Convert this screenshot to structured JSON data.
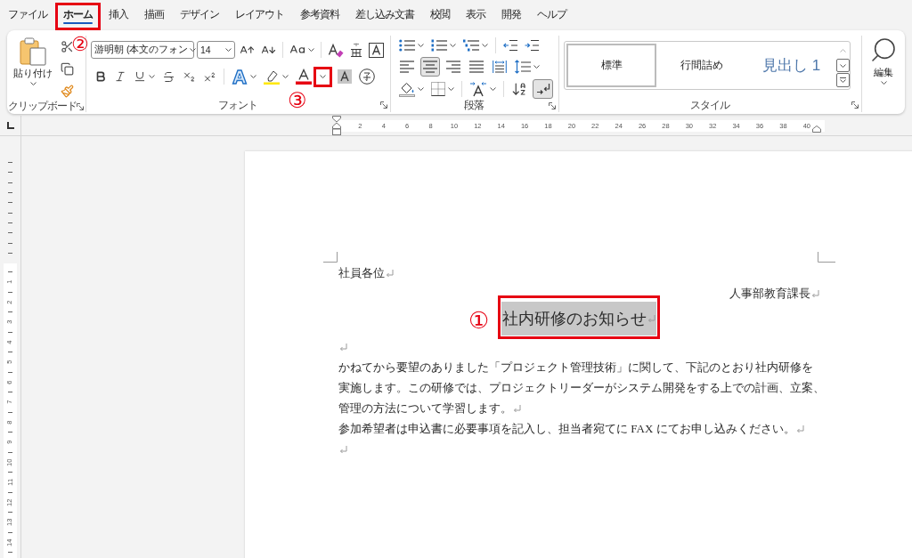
{
  "menu_tabs": [
    {
      "label": "ファイル",
      "selected": false,
      "framed": false
    },
    {
      "label": "ホーム",
      "selected": true,
      "framed": true,
      "callout": "②"
    },
    {
      "label": "挿入",
      "selected": false,
      "framed": false
    },
    {
      "label": "描画",
      "selected": false,
      "framed": false
    },
    {
      "label": "デザイン",
      "selected": false,
      "framed": false
    },
    {
      "label": "レイアウト",
      "selected": false,
      "framed": false
    },
    {
      "label": "参考資料",
      "selected": false,
      "framed": false
    },
    {
      "label": "差し込み文書",
      "selected": false,
      "framed": false
    },
    {
      "label": "校閲",
      "selected": false,
      "framed": false
    },
    {
      "label": "表示",
      "selected": false,
      "framed": false
    },
    {
      "label": "開発",
      "selected": false,
      "framed": false
    },
    {
      "label": "ヘルプ",
      "selected": false,
      "framed": false
    }
  ],
  "ribbon": {
    "clipboard": {
      "paste_label": "貼り付け",
      "group_label": "クリップボード"
    },
    "font": {
      "font_name": "游明朝 (本文のフォン",
      "font_size": "14",
      "font_color_dropdown": {
        "framed": true,
        "callout": "③"
      },
      "group_label": "フォント"
    },
    "paragraph": {
      "alignment": [
        {
          "selected": false
        },
        {
          "selected": true
        },
        {
          "selected": false
        },
        {
          "selected": false
        },
        {
          "selected": false
        }
      ],
      "show_marks": {
        "on": true
      },
      "group_label": "段落"
    },
    "styles": {
      "items": [
        {
          "label": "標準",
          "kind": "normal",
          "selected": true
        },
        {
          "label": "行間詰め",
          "kind": "normal",
          "selected": false
        },
        {
          "label": "見出し 1",
          "kind": "heading",
          "selected": false
        }
      ],
      "group_label": "スタイル"
    },
    "editing": {
      "label": "編集"
    }
  },
  "ruler": {
    "numbers": [
      "2",
      "4",
      "6",
      "8",
      "10",
      "12",
      "14",
      "16",
      "18",
      "20",
      "22",
      "24",
      "26",
      "28",
      "30",
      "32",
      "34",
      "36",
      "38",
      "40"
    ]
  },
  "vertical_ruler": {
    "numbers": [
      "1",
      "2",
      "3",
      "4",
      "5",
      "6",
      "7",
      "8",
      "9",
      "10",
      "11",
      "12",
      "13",
      "14"
    ]
  },
  "document": {
    "paragraphs": [
      {
        "kind": "text",
        "lines": [
          "社員各位"
        ]
      },
      {
        "kind": "signature",
        "lines": [
          "人事部教育課長"
        ]
      },
      {
        "kind": "title",
        "text": "社内研修のお知らせ",
        "shaded": true,
        "framed": true,
        "callout": "①"
      },
      {
        "kind": "empty"
      },
      {
        "kind": "text",
        "lines": [
          "かねてから要望のありました「プロジェクト管理技術」に関して、下記のとおり社内研修を",
          "実施します。この研修では、プロジェクトリーダーがシステム開発をする上での計画、立案、",
          "管理の方法について学習します。"
        ]
      },
      {
        "kind": "text",
        "lines": [
          "参加希望者は申込書に必要事項を記入し、担当者宛てに FAX にてお申し込みください。"
        ]
      },
      {
        "kind": "empty"
      }
    ]
  }
}
